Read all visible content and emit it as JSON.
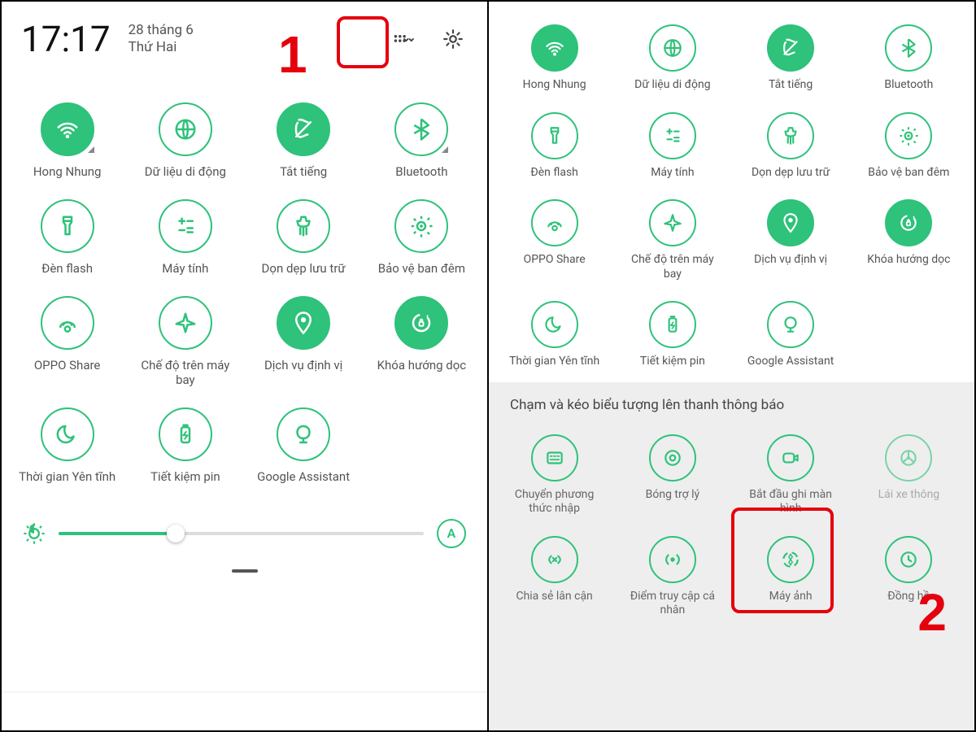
{
  "panel1": {
    "time": "17:17",
    "date_line1": "28 tháng 6",
    "date_line2": "Thứ Hai",
    "step_number": "1",
    "auto_label": "A",
    "tiles": [
      {
        "name": "wifi",
        "label": "Hong Nhung",
        "active": true,
        "corner": true
      },
      {
        "name": "data",
        "label": "Dữ liệu di động",
        "active": false,
        "corner": false
      },
      {
        "name": "mute",
        "label": "Tắt tiếng",
        "active": true,
        "corner": false
      },
      {
        "name": "bluetooth",
        "label": "Bluetooth",
        "active": false,
        "corner": true
      },
      {
        "name": "flashlight",
        "label": "Đèn flash",
        "active": false
      },
      {
        "name": "calculator",
        "label": "Máy tính",
        "active": false
      },
      {
        "name": "cleanup",
        "label": "Dọn dẹp lưu trữ",
        "active": false
      },
      {
        "name": "nightshield",
        "label": "Bảo vệ ban đêm",
        "active": false
      },
      {
        "name": "opposhare",
        "label": "OPPO Share",
        "active": false
      },
      {
        "name": "airplane",
        "label": "Chế độ trên máy bay",
        "active": false
      },
      {
        "name": "location",
        "label": "Dịch vụ định vị",
        "active": true
      },
      {
        "name": "rotationlock",
        "label": "Khóa hướng dọc",
        "active": true
      },
      {
        "name": "quiettime",
        "label": "Thời gian Yên tĩnh",
        "active": false
      },
      {
        "name": "battery",
        "label": "Tiết kiệm pin",
        "active": false
      },
      {
        "name": "assistant",
        "label": "Google Assistant",
        "active": false
      }
    ]
  },
  "panel2": {
    "step_number": "2",
    "instruction": "Chạm và kéo biểu tượng lên thanh thông báo",
    "tiles_top": [
      {
        "name": "wifi",
        "label": "Hong Nhung",
        "active": true
      },
      {
        "name": "data",
        "label": "Dữ liệu di động",
        "active": false
      },
      {
        "name": "mute",
        "label": "Tắt tiếng",
        "active": true
      },
      {
        "name": "bluetooth",
        "label": "Bluetooth",
        "active": false
      },
      {
        "name": "flashlight",
        "label": "Đèn flash",
        "active": false
      },
      {
        "name": "calculator",
        "label": "Máy tính",
        "active": false
      },
      {
        "name": "cleanup",
        "label": "Dọn dẹp lưu trữ",
        "active": false
      },
      {
        "name": "nightshield",
        "label": "Bảo vệ ban đêm",
        "active": false
      },
      {
        "name": "opposhare",
        "label": "OPPO Share",
        "active": false
      },
      {
        "name": "airplane",
        "label": "Chế độ trên máy bay",
        "active": false
      },
      {
        "name": "location",
        "label": "Dịch vụ định vị",
        "active": true
      },
      {
        "name": "rotationlock",
        "label": "Khóa hướng dọc",
        "active": true
      },
      {
        "name": "quiettime",
        "label": "Thời gian Yên tĩnh",
        "active": false
      },
      {
        "name": "battery",
        "label": "Tiết kiệm pin",
        "active": false
      },
      {
        "name": "assistant",
        "label": "Google Assistant",
        "active": false
      }
    ],
    "tiles_extra": [
      {
        "name": "input",
        "label": "Chuyển phương thức nhập"
      },
      {
        "name": "assistball",
        "label": "Bóng trợ lý"
      },
      {
        "name": "record",
        "label": "Bắt đầu ghi màn hình"
      },
      {
        "name": "driving",
        "label": "Lái xe thông",
        "faded": true
      },
      {
        "name": "nearby",
        "label": "Chia sẻ lân cận"
      },
      {
        "name": "hotspot",
        "label": "Điểm truy cập cá nhân"
      },
      {
        "name": "camera",
        "label": "Máy ảnh"
      },
      {
        "name": "clock",
        "label": "Đồng hồ"
      }
    ]
  }
}
